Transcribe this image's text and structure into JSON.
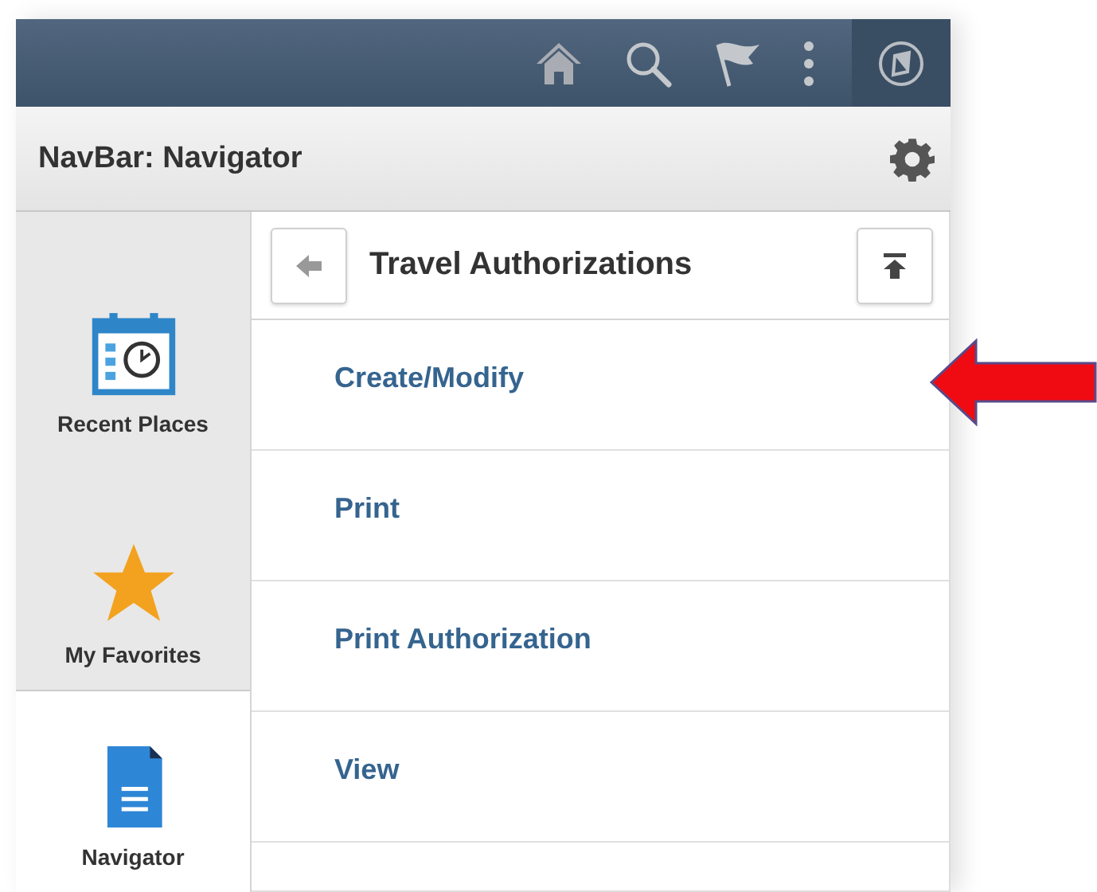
{
  "navbar_title": "NavBar: Navigator",
  "sidebar": {
    "items": [
      {
        "label": "Recent Places",
        "kind": "recent",
        "selected": false
      },
      {
        "label": "My Favorites",
        "kind": "favorites",
        "selected": false
      },
      {
        "label": "Navigator",
        "kind": "navigator",
        "selected": true
      }
    ]
  },
  "panel": {
    "title": "Travel Authorizations",
    "items": [
      {
        "label": "Create/Modify"
      },
      {
        "label": "Print"
      },
      {
        "label": "Print Authorization"
      },
      {
        "label": "View"
      }
    ]
  },
  "annotation": {
    "kind": "arrow"
  }
}
